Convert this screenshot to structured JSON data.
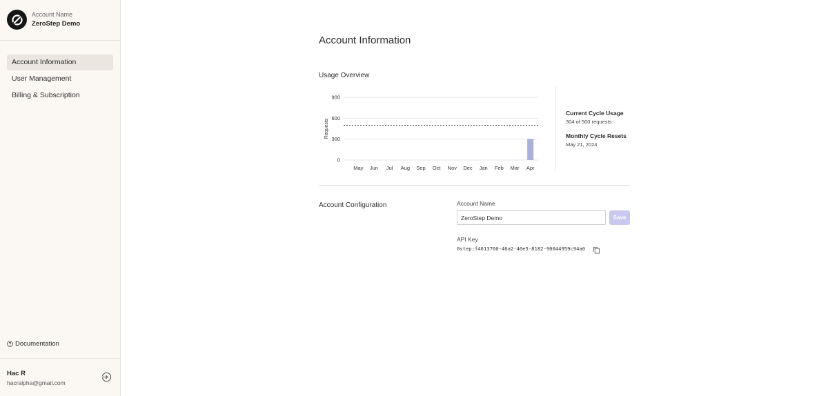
{
  "sidebar": {
    "account_label": "Account Name",
    "account_name": "ZeroStep Demo",
    "nav": [
      {
        "label": "Account Information",
        "active": true
      },
      {
        "label": "User Management",
        "active": false
      },
      {
        "label": "Billing & Subscription",
        "active": false
      }
    ],
    "documentation_label": "Documentation",
    "user_name": "Hac R",
    "user_email": "hacralpha@gmail.com"
  },
  "main": {
    "title": "Account Information",
    "usage_title": "Usage Overview",
    "stats": {
      "current_label": "Current Cycle Usage",
      "current_value": "304 of 500 requests",
      "reset_label": "Monthly Cycle Resets",
      "reset_value": "May 21, 2024"
    },
    "config_title": "Account Configuration",
    "account_name_label": "Account Name",
    "account_name_value": "ZeroStep Demo",
    "save_label": "Save",
    "api_key_label": "API Key",
    "api_key_value": "0step:f4613760-46a2-40e5-8182-90044959c94a0"
  },
  "chart_data": {
    "type": "bar",
    "categories": [
      "May",
      "Jun",
      "Jul",
      "Aug",
      "Sep",
      "Oct",
      "Nov",
      "Dec",
      "Jan",
      "Feb",
      "Mar",
      "Apr"
    ],
    "values": [
      0,
      0,
      0,
      0,
      0,
      0,
      0,
      0,
      0,
      0,
      0,
      304
    ],
    "ylabel": "Requests",
    "ylim": [
      0,
      900
    ],
    "yticks": [
      0,
      300,
      600,
      900
    ],
    "limit_line": 500,
    "grid": true,
    "bar_color": "#aab0dd"
  },
  "colors": {
    "sidebar_bg": "#fbf8f4",
    "active_nav_bg": "#ebe7e0",
    "save_button": "#c9c8ee"
  },
  "icons": {
    "logo": "zerostep-logo-icon",
    "documentation": "help-circle-icon",
    "logout": "logout-icon",
    "copy": "copy-icon"
  }
}
